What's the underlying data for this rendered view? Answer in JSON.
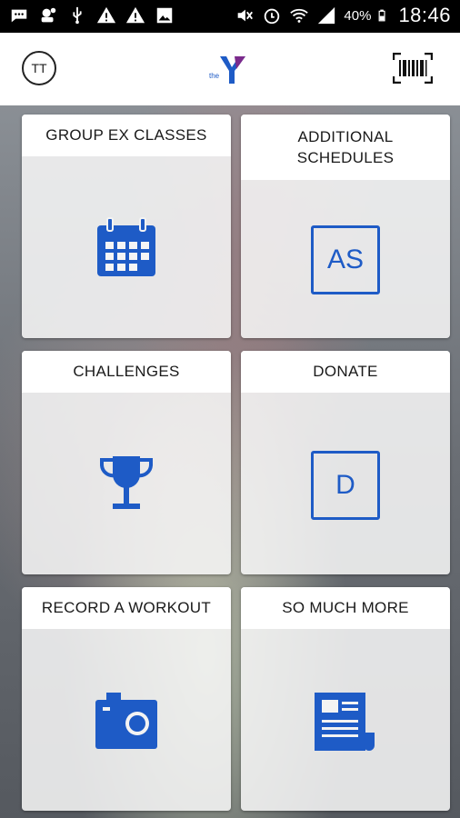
{
  "status_bar": {
    "battery": "40%",
    "time": "18:46"
  },
  "app_bar": {
    "avatar_initials": "TT",
    "logo_small_text": "the"
  },
  "tiles": [
    {
      "label": "GROUP EX CLASSES",
      "icon": "calendar-icon"
    },
    {
      "label": "ADDITIONAL SCHEDULES",
      "icon_text": "AS"
    },
    {
      "label": "CHALLENGES",
      "icon": "trophy-icon"
    },
    {
      "label": "DONATE",
      "icon_text": "D"
    },
    {
      "label": "RECORD A WORKOUT",
      "icon": "camera-icon"
    },
    {
      "label": "SO MUCH MORE",
      "icon": "newspaper-icon"
    }
  ],
  "colors": {
    "accent": "#1e5bc6",
    "logo_purple": "#7b2a8c",
    "logo_blue": "#1e5bc6"
  }
}
